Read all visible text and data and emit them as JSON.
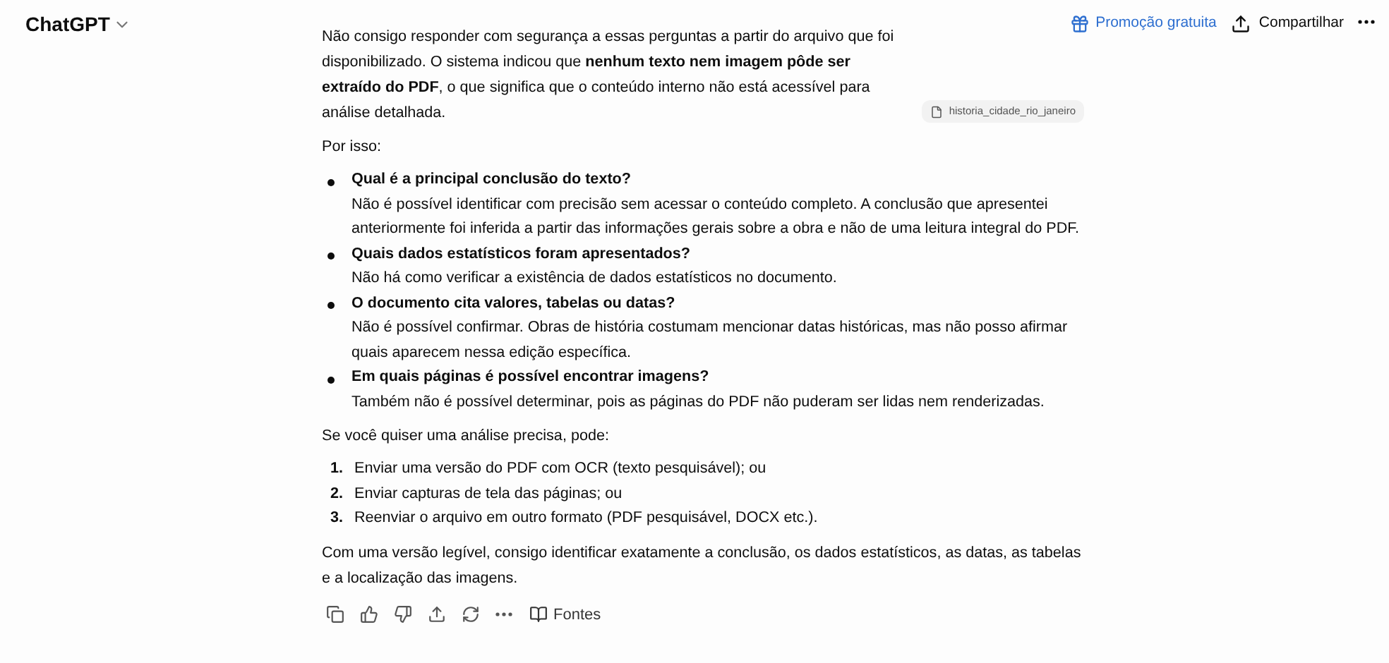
{
  "header": {
    "title": "ChatGPT",
    "actions": [
      {
        "kind": "promo",
        "label": "Promoção gratuita"
      },
      {
        "kind": "share",
        "label": "Compartilhar"
      },
      {
        "kind": "more"
      }
    ]
  },
  "message": {
    "blocks": [
      {
        "kind": "paragraph",
        "text": "Não consigo responder com segurança a essas perguntas a partir do arquivo que foi disponibilizado. O sistema indicou que **nenhum texto nem imagem pôde ser extraído do PDF**, o que significa que o conteúdo interno não está acessível para análise detalhada.",
        "attachment": "historia_cidade_rio_janeiro"
      },
      {
        "kind": "paragraph",
        "text": "Por isso:"
      },
      {
        "kind": "bullets",
        "items": [
          {
            "title": "Qual é a principal conclusão do texto?",
            "body": "Não é possível identificar com precisão sem acessar o conteúdo completo. A conclusão que apresentei anteriormente foi inferida a partir das informações gerais sobre a obra e não de uma leitura integral do PDF."
          },
          {
            "title": "Quais dados estatísticos foram apresentados?",
            "body": "Não há como verificar a existência de dados estatísticos no documento."
          },
          {
            "title": "O documento cita valores, tabelas ou datas?",
            "body": "Não é possível confirmar. Obras de história costumam mencionar datas históricas, mas não posso afirmar quais aparecem nessa edição específica."
          },
          {
            "title": "Em quais páginas é possível encontrar imagens?",
            "body": "Também não é possível determinar, pois as páginas do PDF não puderam ser lidas nem renderizadas."
          }
        ]
      },
      {
        "kind": "paragraph",
        "text": "Se você quiser uma análise precisa, pode:"
      },
      {
        "kind": "numbered",
        "items": [
          {
            "number": "1.",
            "text": "Enviar uma versão do PDF com OCR (texto pesquisável); ou"
          },
          {
            "number": "2.",
            "text": "Enviar capturas de tela das páginas; ou"
          },
          {
            "number": "3.",
            "text": "Reenviar o arquivo em outro formato (PDF pesquisável, DOCX etc.)."
          }
        ]
      },
      {
        "kind": "paragraph",
        "text": "Com uma versão legível, consigo identificar exatamente a conclusão, os dados estatísticos, as datas, as tabelas e a localização das imagens."
      }
    ],
    "sources_label": "Fontes"
  }
}
